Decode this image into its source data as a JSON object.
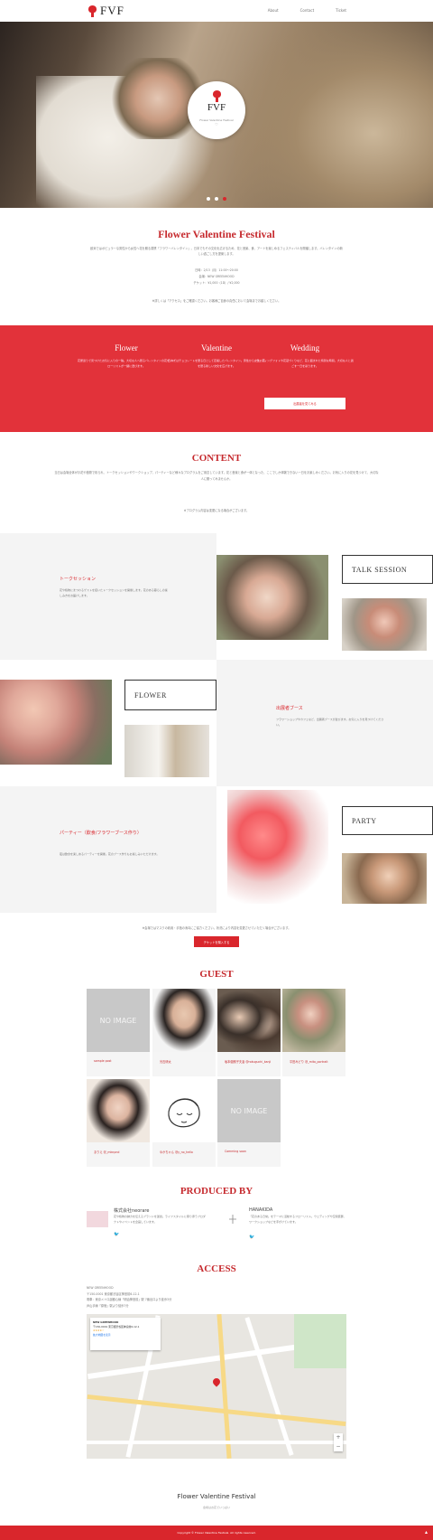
{
  "header": {
    "logo_text": "FVF",
    "nav": [
      "About",
      "Contact",
      "Ticket"
    ]
  },
  "hero": {
    "badge_name": "FVF",
    "badge_sub": "Flower Valentine Festival",
    "badge_dot": "♡",
    "dots": 3,
    "active_dot": 2
  },
  "intro": {
    "title": "Flower Valentine Festival",
    "body": "欧米ではポピュラーな男性から女性へ花を贈る習慣「フラワーバレンタイン」。日本でもその文化を広げるため、花と音楽、食、アートを楽しめるフェスティバルを開催します。バレンタインの新しい過ごし方を提案します。",
    "lines": [
      "日時：2/13（月）11:00〜20:00",
      "会場：NEW GREENHOOD",
      "チケット：¥1,000（1D）/ ¥2,000"
    ],
    "note": "※詳しくは「アクセス」をご確認ください。お客様ご自身の責任において会場までお越しください。"
  },
  "features": {
    "columns": [
      {
        "title": "Flower",
        "text": "花屋巡りで見つけたお気に入りの一輪。大切な人へ贈るバレンタインの花を、フローリストが一緒に選びます。"
      },
      {
        "title": "Valentine",
        "text": "日本ではチョコレートを贈る日として定着したバレンタイン。男性から女性へ花を贈る新しい文化を広げます。"
      },
      {
        "title": "Wedding",
        "text": "ウェディングフォトや花冠づくりなど、花に囲まれた特別な時間。大切な人と過ごす一日を彩ります。"
      }
    ],
    "more_label": "出展者を見てみる"
  },
  "content": {
    "title": "CONTENT",
    "body": "当日は会場全体がお花や植物で彩られ、トークセッションやワークショップ、パーティーなど様々なプログラムをご用意しています。花と音楽と食が一体となった、ここでしか体験できない一日をお楽しみください。お気に入りの花を見つけて、大切な人に贈ってみませんか。",
    "note": "※プログラム内容は変更になる場合がございます。"
  },
  "programs": [
    {
      "label": "トークセッション",
      "tag": "TALK SESSION",
      "text": "花や植物にまつわるゲストを招いたトークセッションを開催します。花のある暮らしの楽しみ方をお届けします。"
    },
    {
      "label": "",
      "tag": "FLOWER",
      "text": ""
    },
    {
      "label": "出展者ブース",
      "tag": "",
      "text": "フラワーショップやカフェなど、出展者ブースが並びます。お気に入りを見つけてください。"
    },
    {
      "label": "パーティー（飲食/フラワーブース作り）",
      "tag": "PARTY",
      "text": "夜は飲食を楽しめるパーティーを開催。花のブース作りもお楽しみいただけます。"
    }
  ],
  "program_note": "※会場ではマスクの着用・手指の消毒にご協力ください。状況により内容を変更させていただく場合がございます。",
  "ticket_label": "チケットを購入する",
  "guests": {
    "title": "GUEST",
    "noimage_label": "NO IMAGE",
    "items": [
      {
        "name": "sample post",
        "noimage": true
      },
      {
        "name": "光石研太",
        "noimage": false
      },
      {
        "name": "坂本健朗子夫妻 @rokuguchi_kanji",
        "noimage": false
      },
      {
        "name": "平田みどり @_mito_portrait",
        "noimage": false
      },
      {
        "name": "まりえ @_mknpnd",
        "noimage": false
      },
      {
        "name": "ゆかちゃん @y_no_hello",
        "noimage": false
      },
      {
        "name": "Comming soon",
        "noimage": true
      }
    ]
  },
  "produced": {
    "title": "PRODUCED BY",
    "orgs": [
      {
        "name": "株式会社neorare",
        "desc": "花や植物の魅力を伝えるブランドを運営。ライフスタイルに寄り添うプロダクトやイベントを企画しています。",
        "twitter": "twitter-icon"
      },
      {
        "name": "HANAKIDA",
        "desc": "「花のある日常」をテーマに活動するフローリスト。ウェディングや空間装飾、ワークショップなどを手がけています。",
        "twitter": "twitter-icon"
      }
    ]
  },
  "access": {
    "title": "ACCESS",
    "lines": [
      "NEW GREENHOOD",
      "〒150-0001 東京都渋谷区神宮前6-12-1",
      "電車：東京メトロ副都心線「明治神宮前」駅 7番出口より徒歩3分",
      "JR山手線「原宿」駅より徒歩7分"
    ],
    "map_card": [
      "NEW GREENHOOD",
      "〒150-0001 東京都渋谷区神宮前6-12-1",
      "★★★★☆",
      "拡大地図を表示"
    ]
  },
  "footer": {
    "title": "Flower Valentine Festival",
    "sub": "会場はお花でいっぱい",
    "copy": "Copyright © Flower Valentine Festival. All rights reserved."
  }
}
